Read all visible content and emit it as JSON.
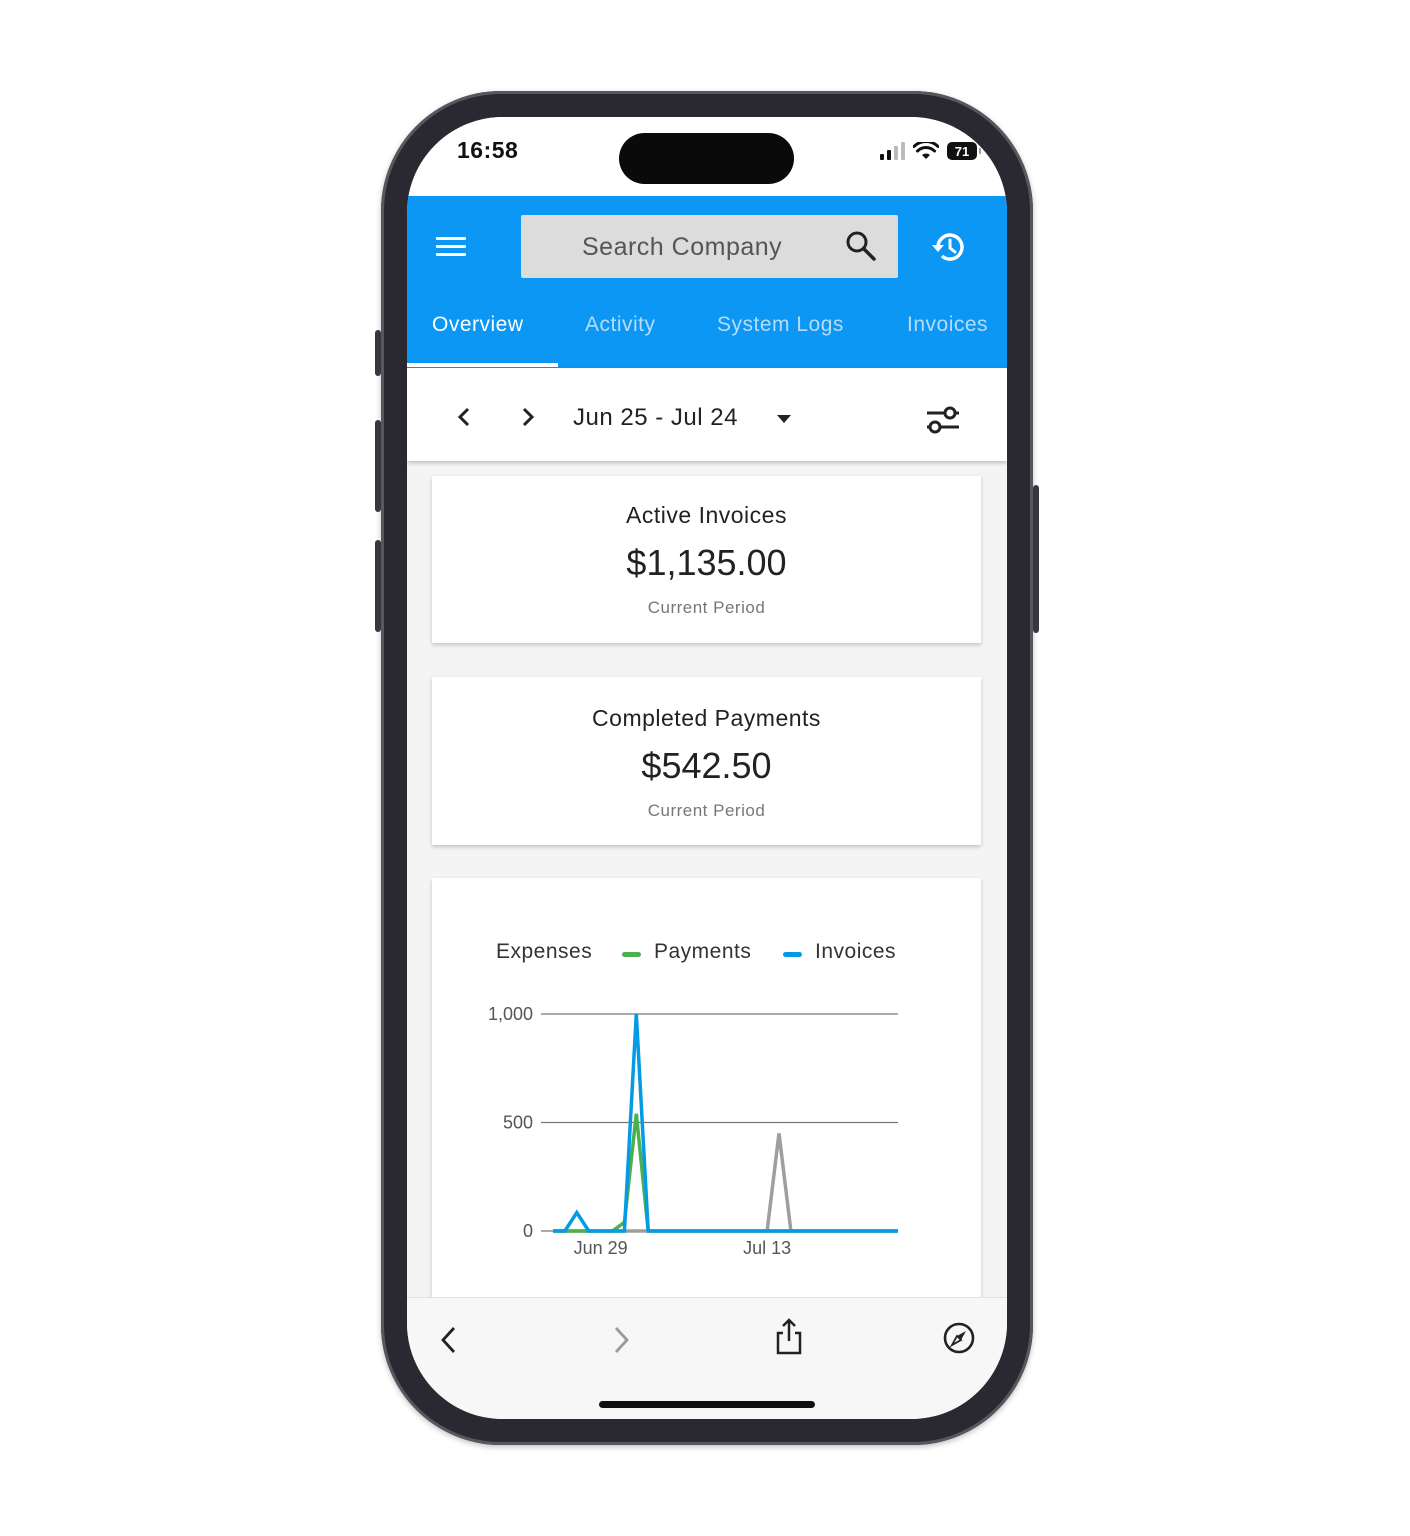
{
  "status_bar": {
    "time": "16:58",
    "battery": "71",
    "signal_icon": "cellular-signal-icon",
    "wifi_icon": "wifi-icon"
  },
  "app_bar": {
    "menu_icon": "hamburger-menu-icon",
    "search": {
      "placeholder": "Search Company",
      "icon": "search-icon"
    },
    "history_icon": "history-icon",
    "color": "#0b97f3"
  },
  "tabs": [
    {
      "label": "Overview",
      "active": true
    },
    {
      "label": "Activity",
      "active": false
    },
    {
      "label": "System Logs",
      "active": false
    },
    {
      "label": "Invoices",
      "active": false
    }
  ],
  "date_bar": {
    "range": "Jun 25 - Jul 24",
    "prev_icon": "chevron-left-icon",
    "next_icon": "chevron-right-icon",
    "filter_icon": "sliders-icon"
  },
  "cards": [
    {
      "title": "Active Invoices",
      "value": "$1,135.00",
      "subtitle": "Current Period"
    },
    {
      "title": "Completed Payments",
      "value": "$542.50",
      "subtitle": "Current Period"
    }
  ],
  "chart_data": {
    "type": "line",
    "legend": [
      {
        "name": "Expenses",
        "color": "#9e9e9e"
      },
      {
        "name": "Payments",
        "color": "#4caf50"
      },
      {
        "name": "Invoices",
        "color": "#039be5"
      }
    ],
    "x_ticks": [
      "Jun 29",
      "Jul 13"
    ],
    "y_ticks": [
      "1,000",
      "500",
      "0"
    ],
    "ylim": [
      0,
      1000
    ],
    "x_domain": [
      "Jun 25",
      "Jul 24"
    ],
    "grid": true,
    "legend_position": "top",
    "series": [
      {
        "name": "Expenses",
        "color": "#9e9e9e",
        "x": [
          "Jun 25",
          "Jun 26",
          "Jun 27",
          "Jun 28",
          "Jun 29",
          "Jun 30",
          "Jul 1",
          "Jul 2",
          "Jul 3",
          "Jul 4",
          "Jul 5",
          "Jul 6",
          "Jul 7",
          "Jul 8",
          "Jul 9",
          "Jul 10",
          "Jul 11",
          "Jul 12",
          "Jul 13",
          "Jul 14",
          "Jul 15",
          "Jul 16",
          "Jul 17",
          "Jul 18",
          "Jul 19",
          "Jul 20",
          "Jul 21",
          "Jul 22",
          "Jul 23",
          "Jul 24"
        ],
        "values": [
          0,
          0,
          0,
          0,
          0,
          0,
          0,
          0,
          0,
          0,
          0,
          0,
          0,
          0,
          0,
          0,
          0,
          0,
          0,
          450,
          0,
          0,
          0,
          0,
          0,
          0,
          0,
          0,
          0,
          0
        ]
      },
      {
        "name": "Payments",
        "color": "#4caf50",
        "x": [
          "Jun 25",
          "Jun 26",
          "Jun 27",
          "Jun 28",
          "Jun 29",
          "Jun 30",
          "Jul 1",
          "Jul 2",
          "Jul 3",
          "Jul 4",
          "Jul 5",
          "Jul 6",
          "Jul 7",
          "Jul 8",
          "Jul 9",
          "Jul 10",
          "Jul 11",
          "Jul 12",
          "Jul 13",
          "Jul 14",
          "Jul 15",
          "Jul 16",
          "Jul 17",
          "Jul 18",
          "Jul 19",
          "Jul 20",
          "Jul 21",
          "Jul 22",
          "Jul 23",
          "Jul 24"
        ],
        "values": [
          0,
          0,
          0,
          0,
          0,
          0,
          40,
          540,
          0,
          0,
          0,
          0,
          0,
          0,
          0,
          0,
          0,
          0,
          0,
          0,
          0,
          0,
          0,
          0,
          0,
          0,
          0,
          0,
          0,
          0
        ]
      },
      {
        "name": "Invoices",
        "color": "#039be5",
        "x": [
          "Jun 25",
          "Jun 26",
          "Jun 27",
          "Jun 28",
          "Jun 29",
          "Jun 30",
          "Jul 1",
          "Jul 2",
          "Jul 3",
          "Jul 4",
          "Jul 5",
          "Jul 6",
          "Jul 7",
          "Jul 8",
          "Jul 9",
          "Jul 10",
          "Jul 11",
          "Jul 12",
          "Jul 13",
          "Jul 14",
          "Jul 15",
          "Jul 16",
          "Jul 17",
          "Jul 18",
          "Jul 19",
          "Jul 20",
          "Jul 21",
          "Jul 22",
          "Jul 23",
          "Jul 24"
        ],
        "values": [
          0,
          0,
          85,
          0,
          0,
          0,
          0,
          1000,
          0,
          0,
          0,
          0,
          0,
          0,
          0,
          0,
          0,
          0,
          0,
          0,
          0,
          0,
          0,
          0,
          0,
          0,
          0,
          0,
          0,
          0
        ]
      }
    ]
  },
  "browser_bar": {
    "back_icon": "back-arrow-icon",
    "forward_icon": "forward-arrow-icon",
    "share_icon": "share-icon",
    "compass_icon": "compass-icon"
  }
}
